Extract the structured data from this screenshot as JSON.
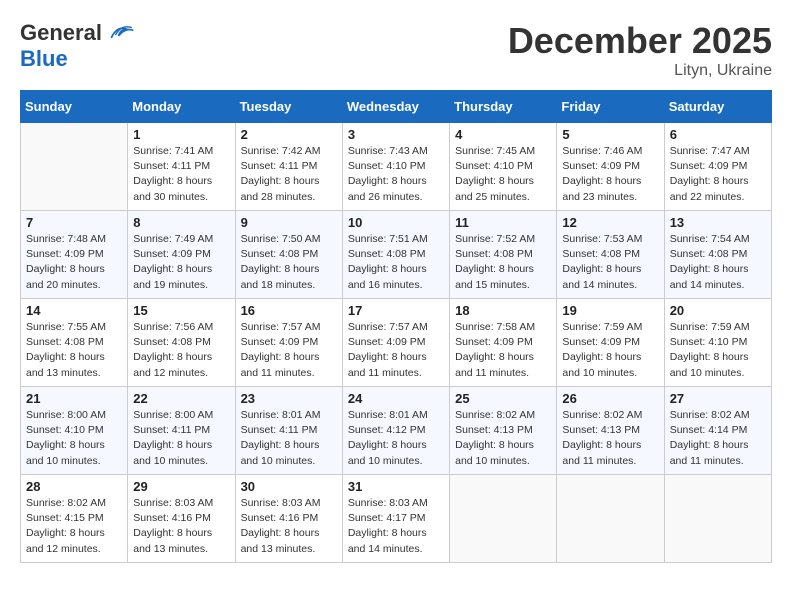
{
  "header": {
    "logo_general": "General",
    "logo_blue": "Blue",
    "month_title": "December 2025",
    "location": "Lityn, Ukraine"
  },
  "weekdays": [
    "Sunday",
    "Monday",
    "Tuesday",
    "Wednesday",
    "Thursday",
    "Friday",
    "Saturday"
  ],
  "weeks": [
    [
      {
        "day": "",
        "info": ""
      },
      {
        "day": "1",
        "info": "Sunrise: 7:41 AM\nSunset: 4:11 PM\nDaylight: 8 hours\nand 30 minutes."
      },
      {
        "day": "2",
        "info": "Sunrise: 7:42 AM\nSunset: 4:11 PM\nDaylight: 8 hours\nand 28 minutes."
      },
      {
        "day": "3",
        "info": "Sunrise: 7:43 AM\nSunset: 4:10 PM\nDaylight: 8 hours\nand 26 minutes."
      },
      {
        "day": "4",
        "info": "Sunrise: 7:45 AM\nSunset: 4:10 PM\nDaylight: 8 hours\nand 25 minutes."
      },
      {
        "day": "5",
        "info": "Sunrise: 7:46 AM\nSunset: 4:09 PM\nDaylight: 8 hours\nand 23 minutes."
      },
      {
        "day": "6",
        "info": "Sunrise: 7:47 AM\nSunset: 4:09 PM\nDaylight: 8 hours\nand 22 minutes."
      }
    ],
    [
      {
        "day": "7",
        "info": "Sunrise: 7:48 AM\nSunset: 4:09 PM\nDaylight: 8 hours\nand 20 minutes."
      },
      {
        "day": "8",
        "info": "Sunrise: 7:49 AM\nSunset: 4:09 PM\nDaylight: 8 hours\nand 19 minutes."
      },
      {
        "day": "9",
        "info": "Sunrise: 7:50 AM\nSunset: 4:08 PM\nDaylight: 8 hours\nand 18 minutes."
      },
      {
        "day": "10",
        "info": "Sunrise: 7:51 AM\nSunset: 4:08 PM\nDaylight: 8 hours\nand 16 minutes."
      },
      {
        "day": "11",
        "info": "Sunrise: 7:52 AM\nSunset: 4:08 PM\nDaylight: 8 hours\nand 15 minutes."
      },
      {
        "day": "12",
        "info": "Sunrise: 7:53 AM\nSunset: 4:08 PM\nDaylight: 8 hours\nand 14 minutes."
      },
      {
        "day": "13",
        "info": "Sunrise: 7:54 AM\nSunset: 4:08 PM\nDaylight: 8 hours\nand 14 minutes."
      }
    ],
    [
      {
        "day": "14",
        "info": "Sunrise: 7:55 AM\nSunset: 4:08 PM\nDaylight: 8 hours\nand 13 minutes."
      },
      {
        "day": "15",
        "info": "Sunrise: 7:56 AM\nSunset: 4:08 PM\nDaylight: 8 hours\nand 12 minutes."
      },
      {
        "day": "16",
        "info": "Sunrise: 7:57 AM\nSunset: 4:09 PM\nDaylight: 8 hours\nand 11 minutes."
      },
      {
        "day": "17",
        "info": "Sunrise: 7:57 AM\nSunset: 4:09 PM\nDaylight: 8 hours\nand 11 minutes."
      },
      {
        "day": "18",
        "info": "Sunrise: 7:58 AM\nSunset: 4:09 PM\nDaylight: 8 hours\nand 11 minutes."
      },
      {
        "day": "19",
        "info": "Sunrise: 7:59 AM\nSunset: 4:09 PM\nDaylight: 8 hours\nand 10 minutes."
      },
      {
        "day": "20",
        "info": "Sunrise: 7:59 AM\nSunset: 4:10 PM\nDaylight: 8 hours\nand 10 minutes."
      }
    ],
    [
      {
        "day": "21",
        "info": "Sunrise: 8:00 AM\nSunset: 4:10 PM\nDaylight: 8 hours\nand 10 minutes."
      },
      {
        "day": "22",
        "info": "Sunrise: 8:00 AM\nSunset: 4:11 PM\nDaylight: 8 hours\nand 10 minutes."
      },
      {
        "day": "23",
        "info": "Sunrise: 8:01 AM\nSunset: 4:11 PM\nDaylight: 8 hours\nand 10 minutes."
      },
      {
        "day": "24",
        "info": "Sunrise: 8:01 AM\nSunset: 4:12 PM\nDaylight: 8 hours\nand 10 minutes."
      },
      {
        "day": "25",
        "info": "Sunrise: 8:02 AM\nSunset: 4:13 PM\nDaylight: 8 hours\nand 10 minutes."
      },
      {
        "day": "26",
        "info": "Sunrise: 8:02 AM\nSunset: 4:13 PM\nDaylight: 8 hours\nand 11 minutes."
      },
      {
        "day": "27",
        "info": "Sunrise: 8:02 AM\nSunset: 4:14 PM\nDaylight: 8 hours\nand 11 minutes."
      }
    ],
    [
      {
        "day": "28",
        "info": "Sunrise: 8:02 AM\nSunset: 4:15 PM\nDaylight: 8 hours\nand 12 minutes."
      },
      {
        "day": "29",
        "info": "Sunrise: 8:03 AM\nSunset: 4:16 PM\nDaylight: 8 hours\nand 13 minutes."
      },
      {
        "day": "30",
        "info": "Sunrise: 8:03 AM\nSunset: 4:16 PM\nDaylight: 8 hours\nand 13 minutes."
      },
      {
        "day": "31",
        "info": "Sunrise: 8:03 AM\nSunset: 4:17 PM\nDaylight: 8 hours\nand 14 minutes."
      },
      {
        "day": "",
        "info": ""
      },
      {
        "day": "",
        "info": ""
      },
      {
        "day": "",
        "info": ""
      }
    ]
  ]
}
